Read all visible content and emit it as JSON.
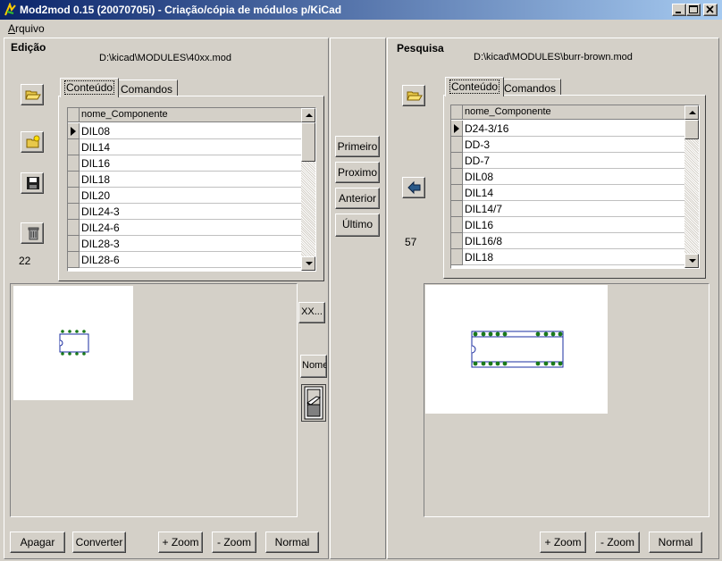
{
  "window": {
    "title": "Mod2mod 0.15 (20070705i) - Criação/cópia de módulos p/KiCad",
    "controls": [
      "minimize",
      "maximize",
      "close"
    ]
  },
  "menu": {
    "items": [
      {
        "label_first": "A",
        "label_rest": "rquivo"
      }
    ]
  },
  "left": {
    "heading": "Edição",
    "path": "D:\\kicad\\MODULES\\40xx.mod",
    "tabs": [
      "Conteúdo",
      "Comandos"
    ],
    "grid_header": "nome_Componente",
    "rows": [
      "DIL08",
      "DIL14",
      "DIL16",
      "DIL18",
      "DIL20",
      "DIL24-3",
      "DIL24-6",
      "DIL28-3",
      "DIL28-6"
    ],
    "count": "22",
    "tool_icons": [
      "open-folder-icon",
      "new-module-icon",
      "save-disk-icon",
      "trash-can-icon"
    ],
    "buttons": {
      "apagar": "Apagar",
      "converter": "Converter",
      "zoom_in": "+ Zoom",
      "zoom_out": "- Zoom",
      "normal": "Normal"
    }
  },
  "center": {
    "nav": {
      "primeiro": "Primeiro",
      "proximo": "Proximo",
      "anterior": "Anterior",
      "ultimo": "Último"
    },
    "xx_button": "XX...",
    "nome_button": "Nome"
  },
  "right": {
    "heading": "Pesquisa",
    "path": "D:\\kicad\\MODULES\\burr-brown.mod",
    "tabs": [
      "Conteúdo",
      "Comandos"
    ],
    "grid_header": "nome_Componente",
    "rows": [
      "D24-3/16",
      "DD-3",
      "DD-7",
      "DIL08",
      "DIL14",
      "DIL14/7",
      "DIL16",
      "DIL16/8",
      "DIL18"
    ],
    "count": "57",
    "tool_icons": [
      "open-folder-icon",
      "copy-left-arrow-icon"
    ],
    "buttons": {
      "zoom_in": "+ Zoom",
      "zoom_out": "- Zoom",
      "normal": "Normal"
    }
  },
  "colors": {
    "titlebar_start": "#0a246a",
    "titlebar_end": "#a6caf0",
    "face": "#d4d0c8",
    "pad_green": "#1a7a1a",
    "outline_blue": "#1a2ca0"
  }
}
